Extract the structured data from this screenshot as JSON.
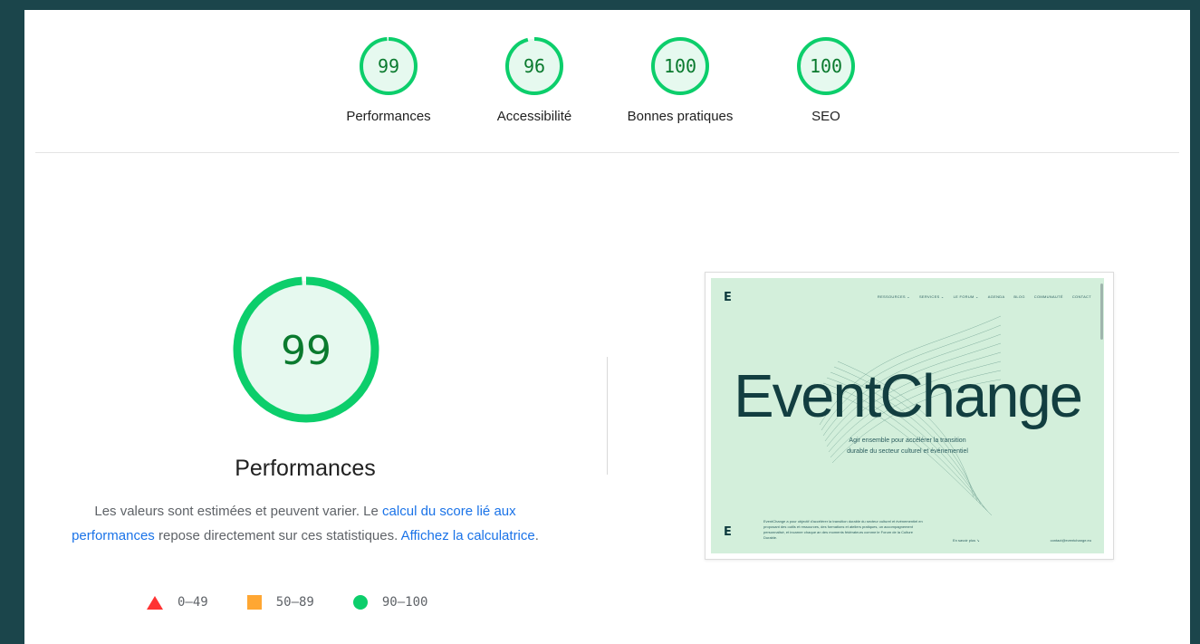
{
  "gauges": [
    {
      "score": "99",
      "label": "Performances",
      "fraction": 0.99
    },
    {
      "score": "96",
      "label": "Accessibilité",
      "fraction": 0.96
    },
    {
      "score": "100",
      "label": "Bonnes pratiques",
      "fraction": 1.0
    },
    {
      "score": "100",
      "label": "SEO",
      "fraction": 1.0
    }
  ],
  "main": {
    "score": "99",
    "fraction": 0.99,
    "title": "Performances",
    "desc_1": "Les valeurs sont estimées et peuvent varier. Le ",
    "link_calc": "calcul du score lié aux performances",
    "desc_2": " repose directement sur ces statistiques. ",
    "link_calculator": "Affichez la calculatrice",
    "desc_3": "."
  },
  "legend": [
    {
      "range": "0–49",
      "shape": "triangle",
      "color": "#ff3333"
    },
    {
      "range": "50–89",
      "shape": "square",
      "color": "#ffa733"
    },
    {
      "range": "90–100",
      "shape": "circle",
      "color": "#0cce6b"
    }
  ],
  "thumbnail": {
    "logo": "E",
    "nav": [
      "RESSOURCES ⌄",
      "SERVICES ⌄",
      "LE FORUM ⌄",
      "AGENDA",
      "BLOG",
      "COMMUNAUTÉ",
      "CONTACT"
    ],
    "hero": "EventChange",
    "tagline": "Agir ensemble pour accélérer la transition durable du secteur culturel et événementiel",
    "footer_text": "EventChange a pour objectif d'accélérer la transition durable du secteur culturel et événementiel en proposant des outils et ressources, des formations et ateliers pratiques, un accompagnement personnalisé, et incarner chaque an des moments fédérateurs comme le Forum de la Culture Durable.",
    "more": "En savoir plus  ↘",
    "email": "contact@eventchange.eu"
  },
  "colors": {
    "pass_stroke": "#0cce6b",
    "pass_fill": "#e6f9ef",
    "pass_text": "#0a7a2e",
    "link": "#1a73e8",
    "background": "#1b454b"
  }
}
